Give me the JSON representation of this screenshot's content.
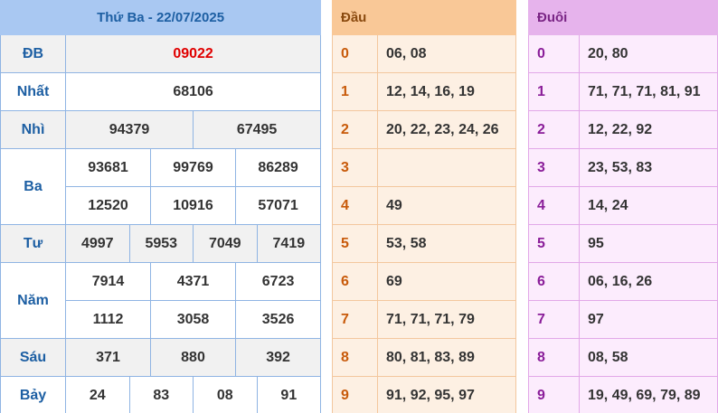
{
  "results": {
    "header": "Thứ Ba - 22/07/2025",
    "prizes": [
      {
        "label": "ĐB",
        "rows": [
          [
            "09022"
          ]
        ]
      },
      {
        "label": "Nhất",
        "rows": [
          [
            "68106"
          ]
        ]
      },
      {
        "label": "Nhì",
        "rows": [
          [
            "94379",
            "67495"
          ]
        ]
      },
      {
        "label": "Ba",
        "rows": [
          [
            "93681",
            "99769",
            "86289"
          ],
          [
            "12520",
            "10916",
            "57071"
          ]
        ]
      },
      {
        "label": "Tư",
        "rows": [
          [
            "4997",
            "5953",
            "7049",
            "7419"
          ]
        ]
      },
      {
        "label": "Năm",
        "rows": [
          [
            "7914",
            "4371",
            "6723"
          ],
          [
            "1112",
            "3058",
            "3526"
          ]
        ]
      },
      {
        "label": "Sáu",
        "rows": [
          [
            "371",
            "880",
            "392"
          ]
        ]
      },
      {
        "label": "Bảy",
        "rows": [
          [
            "24",
            "83",
            "08",
            "91"
          ]
        ]
      }
    ]
  },
  "dau": {
    "header": "Đầu",
    "rows": [
      {
        "digit": "0",
        "values": "06, 08"
      },
      {
        "digit": "1",
        "values": "12, 14, 16, 19"
      },
      {
        "digit": "2",
        "values": "20, 22, 23, 24, 26"
      },
      {
        "digit": "3",
        "values": ""
      },
      {
        "digit": "4",
        "values": "49"
      },
      {
        "digit": "5",
        "values": "53, 58"
      },
      {
        "digit": "6",
        "values": "69"
      },
      {
        "digit": "7",
        "values": "71, 71, 71, 79"
      },
      {
        "digit": "8",
        "values": "80, 81, 83, 89"
      },
      {
        "digit": "9",
        "values": "91, 92, 95, 97"
      }
    ]
  },
  "duoi": {
    "header": "Đuôi",
    "rows": [
      {
        "digit": "0",
        "values": "20, 80"
      },
      {
        "digit": "1",
        "values": "71, 71, 71, 81, 91"
      },
      {
        "digit": "2",
        "values": "12, 22, 92"
      },
      {
        "digit": "3",
        "values": "23, 53, 83"
      },
      {
        "digit": "4",
        "values": "14, 24"
      },
      {
        "digit": "5",
        "values": "95"
      },
      {
        "digit": "6",
        "values": "06, 16, 26"
      },
      {
        "digit": "7",
        "values": "97"
      },
      {
        "digit": "8",
        "values": "08, 58"
      },
      {
        "digit": "9",
        "values": "19, 49, 69, 79, 89"
      }
    ]
  },
  "colors": {
    "results_header_bg": "#a9c8f2",
    "special_prize": "#e00000",
    "dau_header_bg": "#f9c897",
    "duoi_header_bg": "#e6b3ec"
  }
}
